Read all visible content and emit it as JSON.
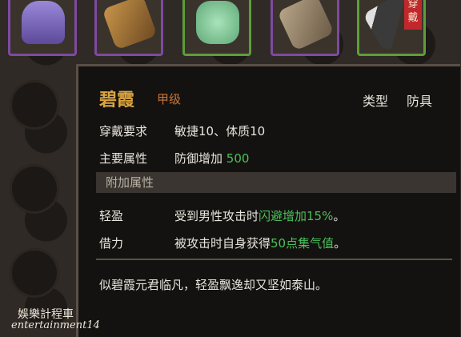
{
  "item": {
    "name": "碧霞",
    "grade": "甲级",
    "type_label": "类型",
    "type_value": "防具",
    "requirement_label": "穿戴要求",
    "requirement_value": "敏捷10、体质10",
    "main_attr_label": "主要属性",
    "main_attr_prefix": "防御增加 ",
    "main_attr_value": "500",
    "extra_section": "附加属性",
    "bonus1_label": "轻盈",
    "bonus1_prefix": "受到男性攻击时",
    "bonus1_highlight": "闪避增加15%",
    "bonus1_suffix": "。",
    "bonus2_label": "借力",
    "bonus2_prefix": "被攻击时自身获得",
    "bonus2_highlight": "50点集气值",
    "bonus2_suffix": "。",
    "description": "似碧霞元君临凡，轻盈飘逸却又坚如泰山。"
  },
  "inventory_top": [
    {
      "icon": "purple-robe-icon",
      "frame": "purple"
    },
    {
      "icon": "bronze-armor-icon",
      "frame": "purple"
    },
    {
      "icon": "jade-stone-icon",
      "frame": "green"
    },
    {
      "icon": "bracer-icon",
      "frame": "purple"
    },
    {
      "icon": "sword-icon",
      "frame": "green",
      "tag": "穿戴"
    }
  ],
  "watermark": {
    "line1": "娛樂計程車",
    "line2": "entertainment14"
  },
  "colors": {
    "name": "#d9a441",
    "grade": "#c7763a",
    "highlight": "#49c05a",
    "purple_frame": "#7e4aa0",
    "green_frame": "#5d9d3a"
  }
}
